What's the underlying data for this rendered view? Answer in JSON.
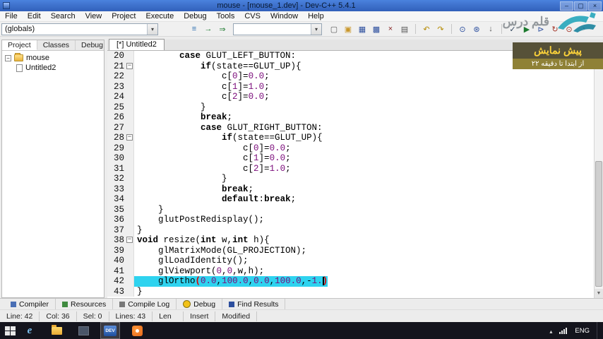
{
  "window": {
    "title": "mouse - [mouse_1.dev] - Dev-C++ 5.4.1",
    "minimize": "–",
    "maximize": "▢",
    "close": "×"
  },
  "menubar": {
    "items": [
      "File",
      "Edit",
      "Search",
      "View",
      "Project",
      "Execute",
      "Debug",
      "Tools",
      "CVS",
      "Window",
      "Help"
    ]
  },
  "toolbar": {
    "globals_combo": "(globals)",
    "class_combo": "",
    "nav_icons": [
      {
        "name": "class-browser-icon",
        "glyph": "≡",
        "color": "#2f6fb0"
      },
      {
        "name": "goto-declaration-icon",
        "glyph": "→",
        "color": "#1c7a2e"
      },
      {
        "name": "goto-definition-icon",
        "glyph": "⇒",
        "color": "#1c7a2e"
      }
    ],
    "groups": [
      [
        {
          "name": "new-file-icon",
          "glyph": "▢",
          "color": "#5a5a5a"
        },
        {
          "name": "open-icon",
          "glyph": "▣",
          "color": "#c9972b"
        },
        {
          "name": "save-icon",
          "glyph": "▦",
          "color": "#2d4f9e"
        },
        {
          "name": "save-all-icon",
          "glyph": "▩",
          "color": "#2d4f9e"
        },
        {
          "name": "close-file-icon",
          "glyph": "×",
          "color": "#8a2727"
        },
        {
          "name": "print-icon",
          "glyph": "▤",
          "color": "#555555"
        }
      ],
      [
        {
          "name": "undo-icon",
          "glyph": "↶",
          "color": "#b58a00"
        },
        {
          "name": "redo-icon",
          "glyph": "↷",
          "color": "#b58a00"
        }
      ],
      [
        {
          "name": "find-icon",
          "glyph": "⊙",
          "color": "#2d4f9e"
        },
        {
          "name": "replace-icon",
          "glyph": "⊛",
          "color": "#2d4f9e"
        },
        {
          "name": "goto-line-icon",
          "glyph": "↓",
          "color": "#555555"
        }
      ],
      [
        {
          "name": "compile-icon",
          "glyph": "✓",
          "color": "#33475e"
        },
        {
          "name": "run-icon",
          "glyph": "▶",
          "color": "#1c7a2e"
        },
        {
          "name": "compile-run-icon",
          "glyph": "⊳",
          "color": "#2d4f9e"
        },
        {
          "name": "rebuild-icon",
          "glyph": "↻",
          "color": "#a33327"
        },
        {
          "name": "debug-icon",
          "glyph": "⊙",
          "color": "#a33327"
        },
        {
          "name": "profile-icon",
          "glyph": "◔",
          "color": "#555555"
        }
      ]
    ]
  },
  "left_panel": {
    "tabs": [
      {
        "label": "Project",
        "active": true
      },
      {
        "label": "Classes",
        "active": false
      },
      {
        "label": "Debug",
        "active": false
      }
    ],
    "tree": [
      {
        "label": "mouse",
        "level": 0,
        "icon": "folder",
        "expanded": true
      },
      {
        "label": "Untitled2",
        "level": 1,
        "icon": "file"
      }
    ]
  },
  "editor": {
    "tab": "[*] Untitled2",
    "first_line": 20,
    "current_line": 42,
    "caret_col": 35,
    "fold_lines": [
      21,
      28,
      38
    ],
    "colors": {
      "current_line_bg": "#2ed3ef",
      "keyword": "#000000",
      "number": "#7a0b7a",
      "brace_match": "#e00000"
    },
    "lines": [
      "        case GLUT_LEFT_BUTTON:",
      "            if(state==GLUT_UP){",
      "                c[0]=0.0;",
      "                c[1]=1.0;",
      "                c[2]=0.0;",
      "            }",
      "            break;",
      "            case GLUT_RIGHT_BUTTON:",
      "                if(state==GLUT_UP){",
      "                    c[0]=0.0;",
      "                    c[1]=0.0;",
      "                    c[2]=1.0;",
      "                }",
      "                break;",
      "                default:break;",
      "    }",
      "    glutPostRedisplay();",
      "}",
      "void resize(int w,int h){",
      "    glMatrixMode(GL_PROJECTION);",
      "    glLoadIdentity();",
      "    glViewport(0,0,w,h);",
      "    glOrtho(0.0,100.0,0.0,100.0,-1.)",
      "}"
    ]
  },
  "report_tabs": [
    {
      "label": "Compiler",
      "icon_color": "#4a6fb5",
      "shape": "square"
    },
    {
      "label": "Resources",
      "icon_color": "#3f8a3f",
      "shape": "square"
    },
    {
      "label": "Compile Log",
      "icon_color": "#777777",
      "shape": "square"
    },
    {
      "label": "Debug",
      "icon_color": "#f2c218",
      "shape": "circle"
    },
    {
      "label": "Find Results",
      "icon_color": "#2d4f9e",
      "shape": "square"
    }
  ],
  "statusbar": {
    "segments": [
      "Line: 42",
      "Col: 36",
      "Sel: 0",
      "Lines: 43",
      "Len",
      "Insert",
      "Modified"
    ]
  },
  "taskbar": {
    "ie_label": "e",
    "dev_label": "DEV",
    "lang": "ENG"
  },
  "watermark": {
    "brand": "قلم درس",
    "preview_title": "پیش نمایش",
    "preview_subtitle": "از ابتدا تا دقیقه ۲۲"
  }
}
